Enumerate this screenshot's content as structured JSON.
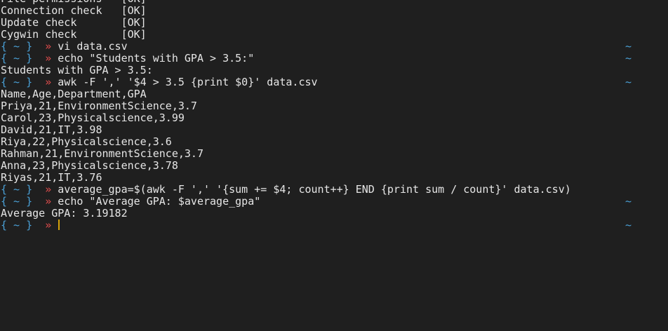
{
  "terminal": {
    "colors": {
      "background": "#1f1f1f",
      "text": "#e6e6e6",
      "prompt_brace": "#4aa0d6",
      "prompt_arrow": "#e04c4c",
      "cursor": "#d4a20a"
    },
    "prompt": {
      "brace": "{ ~ }",
      "arrow": "»",
      "right_tilde": "~"
    },
    "lines": [
      {
        "type": "output",
        "text": "File permissions   [OK]"
      },
      {
        "type": "output",
        "text": "Connection check   [OK]"
      },
      {
        "type": "output",
        "text": "Update check       [OK]"
      },
      {
        "type": "output",
        "text": "Cygwin check       [OK]"
      },
      {
        "type": "prompt",
        "command": "vi data.csv",
        "right_tilde": true
      },
      {
        "type": "prompt",
        "command": "echo \"Students with GPA > 3.5:\"",
        "right_tilde": true
      },
      {
        "type": "output",
        "text": "Students with GPA > 3.5:"
      },
      {
        "type": "prompt",
        "command": "awk -F ',' '$4 > 3.5 {print $0}' data.csv",
        "right_tilde": true
      },
      {
        "type": "output",
        "text": "Name,Age,Department,GPA"
      },
      {
        "type": "output",
        "text": "Priya,21,EnvironmentScience,3.7"
      },
      {
        "type": "output",
        "text": "Carol,23,Physicalscience,3.99"
      },
      {
        "type": "output",
        "text": "David,21,IT,3.98"
      },
      {
        "type": "output",
        "text": "Riya,22,Physicalscience,3.6"
      },
      {
        "type": "output",
        "text": "Rahman,21,EnvironmentScience,3.7"
      },
      {
        "type": "output",
        "text": "Anna,23,Physicalscience,3.78"
      },
      {
        "type": "output",
        "text": "Riyas,21,IT,3.76"
      },
      {
        "type": "prompt",
        "command": "average_gpa=$(awk -F ',' '{sum += $4; count++} END {print sum / count}' data.csv)",
        "right_tilde": false
      },
      {
        "type": "prompt",
        "command": "echo \"Average GPA: $average_gpa\"",
        "right_tilde": true
      },
      {
        "type": "output",
        "text": "Average GPA: 3.19182"
      },
      {
        "type": "prompt",
        "command": "",
        "right_tilde": true,
        "cursor": true
      }
    ]
  }
}
